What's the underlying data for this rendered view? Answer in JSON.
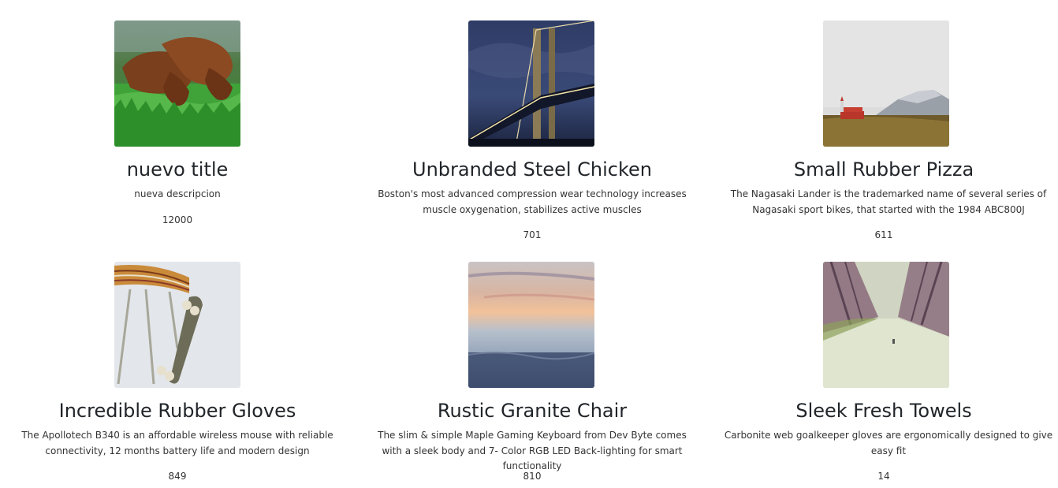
{
  "products": [
    {
      "title": "nuevo title",
      "description": "nueva descripcion",
      "price": "12000",
      "image_icon": "dogs-in-grass-photo"
    },
    {
      "title": "Unbranded Steel Chicken",
      "description": "Boston's most advanced compression wear technology increases muscle oxygenation, stabilizes active muscles",
      "price": "701",
      "image_icon": "bridge-at-night-photo"
    },
    {
      "title": "Small Rubber Pizza",
      "description": "The Nagasaki Lander is the trademarked name of several series of Nagasaki sport bikes, that started with the 1984 ABC800J",
      "price": "611",
      "image_icon": "church-and-mountain-photo"
    },
    {
      "title": "Incredible Rubber Gloves",
      "description": "The Apollotech B340 is an affordable wireless mouse with reliable connectivity, 12 months battery life and modern design",
      "price": "849",
      "image_icon": "skateboard-and-stool-photo"
    },
    {
      "title": "Rustic Granite Chair",
      "description": "The slim & simple Maple Gaming Keyboard from Dev Byte comes with a sleek body and 7- Color RGB LED Back-lighting for smart functionality",
      "price": "810",
      "image_icon": "misty-sea-sunset-photo"
    },
    {
      "title": "Sleek Fresh Towels",
      "description": "Carbonite web goalkeeper gloves are ergonomically designed to give easy fit",
      "price": "14",
      "image_icon": "tree-lined-road-photo"
    }
  ]
}
